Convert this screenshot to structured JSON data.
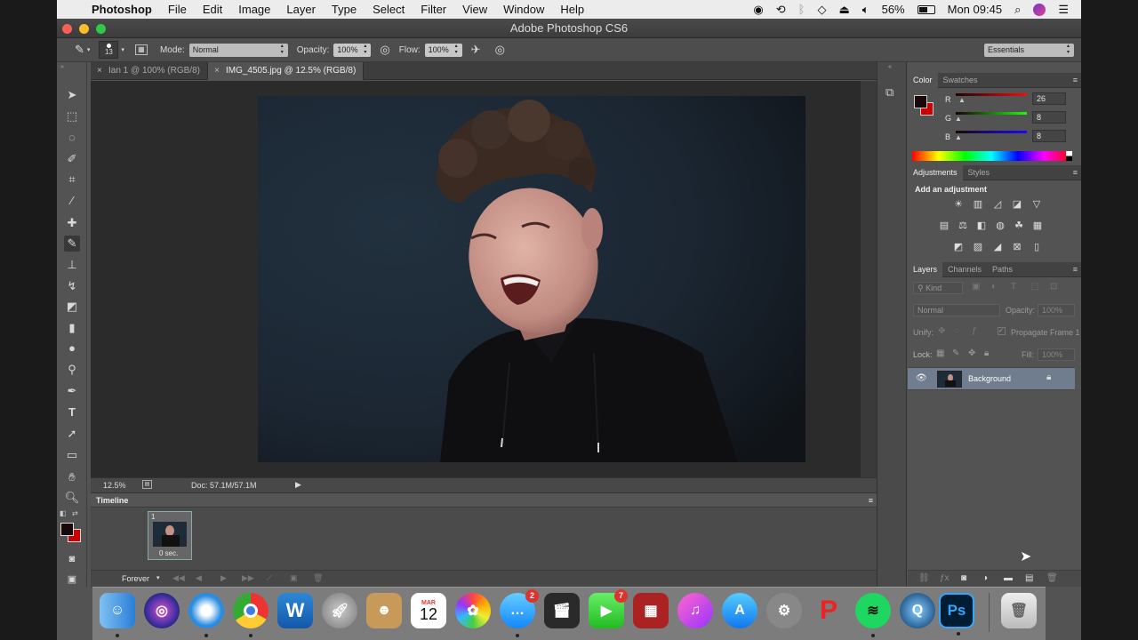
{
  "menubar": {
    "apple": "",
    "app": "Photoshop",
    "items": [
      "File",
      "Edit",
      "Image",
      "Layer",
      "Type",
      "Select",
      "Filter",
      "View",
      "Window",
      "Help"
    ],
    "battery": "56%",
    "clock": "Mon 09:45"
  },
  "window": {
    "title": "Adobe Photoshop CS6"
  },
  "options": {
    "brush_size": "13",
    "mode_label": "Mode:",
    "mode_value": "Normal",
    "opacity_label": "Opacity:",
    "opacity_value": "100%",
    "flow_label": "Flow:",
    "flow_value": "100%",
    "workspace": "Essentials"
  },
  "tabs": [
    {
      "label": "Ian 1 @ 100% (RGB/8)",
      "active": false
    },
    {
      "label": "IMG_4505.jpg @ 12.5% (RGB/8)",
      "active": true
    }
  ],
  "status": {
    "zoom": "12.5%",
    "doc": "Doc: 57.1M/57.1M"
  },
  "timeline": {
    "title": "Timeline",
    "frame_number": "1",
    "frame_delay": "0 sec.",
    "loop": "Forever"
  },
  "color_panel": {
    "tabs": [
      "Color",
      "Swatches"
    ],
    "r_label": "R",
    "r_value": "26",
    "g_label": "G",
    "g_value": "8",
    "b_label": "B",
    "b_value": "8",
    "foreground": "#1a0808",
    "background": "#cc0000"
  },
  "adjustments_panel": {
    "tabs": [
      "Adjustments",
      "Styles"
    ],
    "subtitle": "Add an adjustment"
  },
  "layers_panel": {
    "tabs": [
      "Layers",
      "Channels",
      "Paths"
    ],
    "kind_label": "Kind",
    "blend_mode": "Normal",
    "opacity_label": "Opacity:",
    "opacity_value": "100%",
    "unify_label": "Unify:",
    "propagate_label": "Propagate Frame 1",
    "lock_label": "Lock:",
    "fill_label": "Fill:",
    "fill_value": "100%",
    "layer_name": "Background"
  },
  "dock": {
    "calendar_month": "MAR",
    "calendar_day": "12",
    "messages_badge": "2",
    "facetime_badge": "7",
    "photoshop_label": "Ps"
  }
}
